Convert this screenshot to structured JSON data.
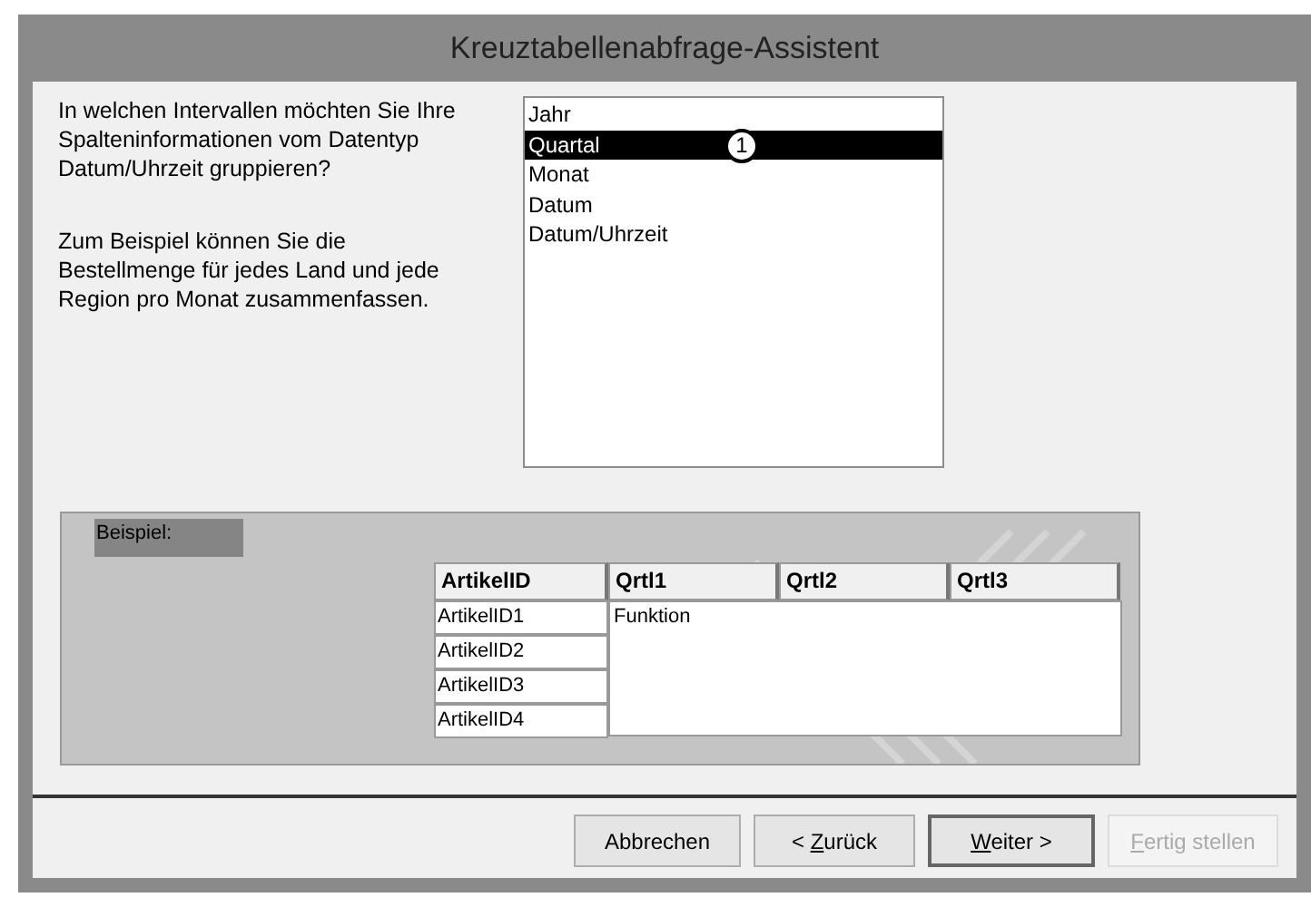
{
  "window": {
    "title": "Kreuztabellenabfrage-Assistent"
  },
  "question": "In welchen Intervallen möchten Sie Ihre Spalteninformationen vom Datentyp Datum/Uhrzeit gruppieren?",
  "example_text": "Zum Beispiel können Sie die Bestellmenge für jedes Land und jede Region pro Monat zusammenfassen.",
  "intervals": [
    {
      "label": "Jahr",
      "selected": false
    },
    {
      "label": "Quartal",
      "selected": true
    },
    {
      "label": "Monat",
      "selected": false
    },
    {
      "label": "Datum",
      "selected": false
    },
    {
      "label": "Datum/Uhrzeit",
      "selected": false
    }
  ],
  "callout": "1",
  "example": {
    "label": "Beispiel:",
    "columns": [
      "ArtikelID",
      "Qrtl1",
      "Qrtl2",
      "Qrtl3"
    ],
    "rows": [
      "ArtikelID1",
      "ArtikelID2",
      "ArtikelID3",
      "ArtikelID4"
    ],
    "value": "Funktion"
  },
  "buttons": [
    {
      "after": "Abbrechen",
      "disabled": false,
      "default": false
    },
    {
      "before": "< ",
      "key": "Z",
      "after": "urück",
      "disabled": false,
      "default": false
    },
    {
      "key": "W",
      "after": "eiter >",
      "disabled": false,
      "default": true
    },
    {
      "key": "F",
      "after": "ertig stellen",
      "disabled": true,
      "default": false
    }
  ]
}
